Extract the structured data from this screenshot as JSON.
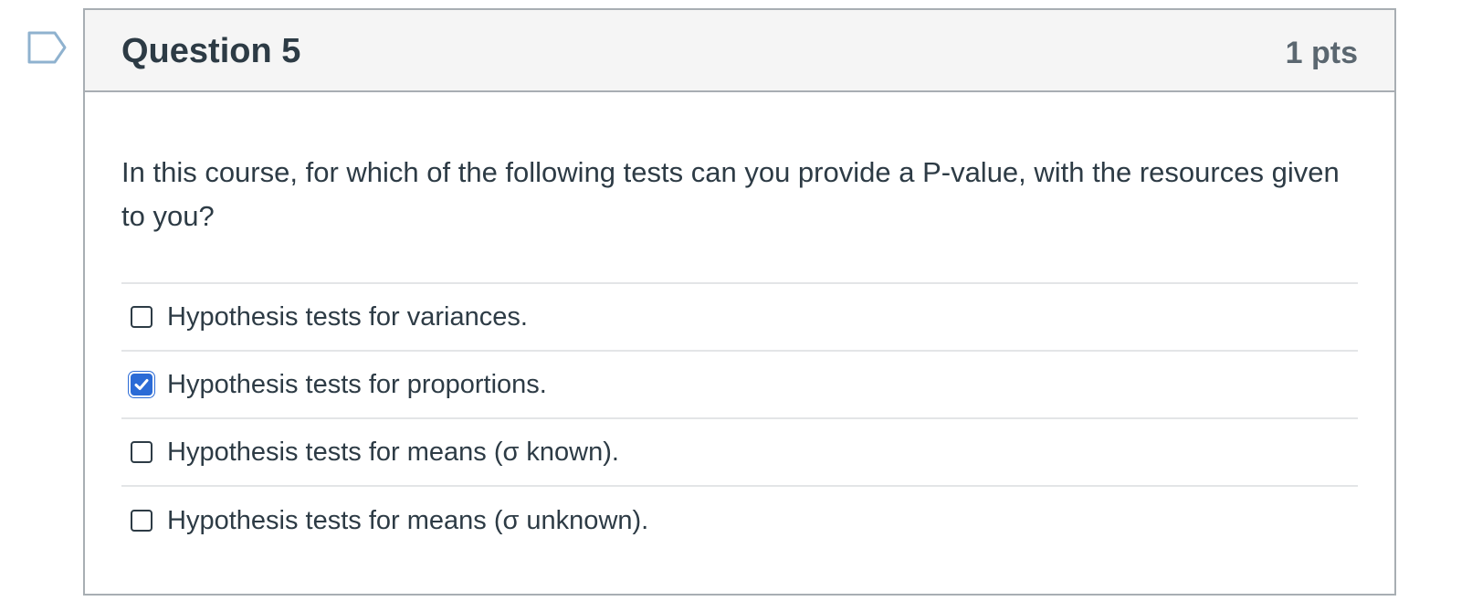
{
  "flag": {
    "icon": "flag-marker-icon",
    "color": "#8fb2cf"
  },
  "question": {
    "title": "Question 5",
    "points": "1 pts",
    "text": "In this course, for which of the following tests can you provide a P-value, with the resources given to you?"
  },
  "answers": [
    {
      "label": "Hypothesis tests for variances.",
      "checked": false
    },
    {
      "label": "Hypothesis tests for proportions.",
      "checked": true
    },
    {
      "label": "Hypothesis tests for means (σ known).",
      "checked": false
    },
    {
      "label": "Hypothesis tests for means (σ unknown).",
      "checked": false
    }
  ],
  "colors": {
    "checked_fill": "#2b6bd6",
    "text": "#2d3b45",
    "border": "#a8aeb3"
  }
}
